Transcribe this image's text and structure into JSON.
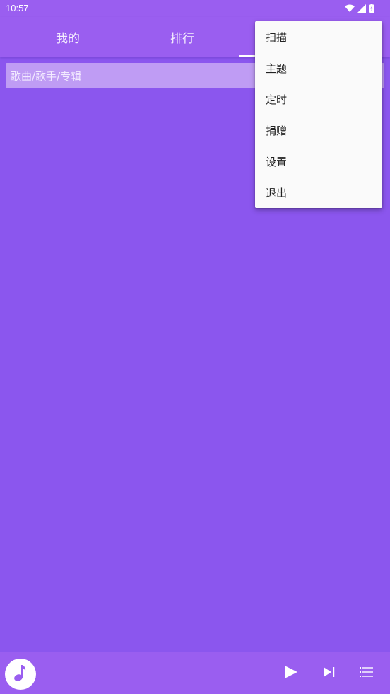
{
  "status_bar": {
    "time": "10:57",
    "icons": [
      "wifi-icon",
      "signal-icon",
      "battery-charging-icon"
    ]
  },
  "tabs": [
    {
      "label": "我的"
    },
    {
      "label": "排行"
    },
    {
      "label": "",
      "selected": true
    }
  ],
  "search": {
    "placeholder": "歌曲/歌手/专辑"
  },
  "overflow_menu": {
    "items": [
      {
        "label": "扫描"
      },
      {
        "label": "主题"
      },
      {
        "label": "定时"
      },
      {
        "label": "捐赠"
      },
      {
        "label": "设置"
      },
      {
        "label": "退出"
      }
    ]
  },
  "player_bar": {
    "album_icon": "music-note-icon",
    "controls": [
      "play-icon",
      "skip-next-icon",
      "playlist-icon"
    ]
  },
  "colors": {
    "primary": "#9a5ef0",
    "background": "#8b56ee",
    "search_bg": "#bf9cf4",
    "menu_bg": "#fafafa"
  }
}
